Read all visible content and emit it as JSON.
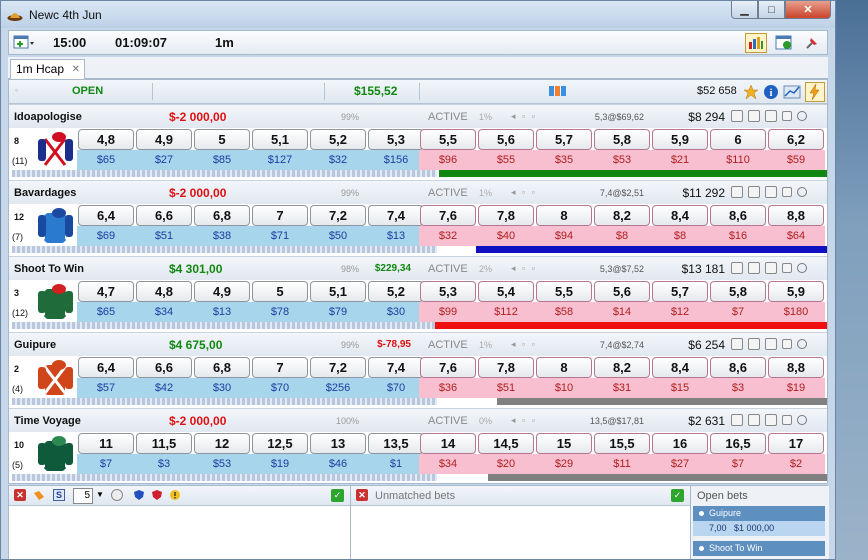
{
  "window": {
    "title": "Newc 4th Jun"
  },
  "toolbar": {
    "time": "15:00",
    "countdown": "01:09:07",
    "market": "1m"
  },
  "tab": {
    "label": "1m Hcap"
  },
  "status": {
    "state": "OPEN",
    "amount": "$155,52",
    "bank": "$52 658"
  },
  "runners": [
    {
      "name": "Idoapologise",
      "pl": "$-2 000,00",
      "pl_color": "#e01010",
      "pct": "99%",
      "extra": "",
      "extra_color": "#118811",
      "status": "ACTIVE",
      "status_pct": "1%",
      "last": "5,3@$69,62",
      "matched": "$8 294",
      "cloth": "8",
      "draw": "(11)",
      "back_odds": [
        "4,8",
        "4,9",
        "5",
        "5,1",
        "5,2",
        "5,3"
      ],
      "back_amts": [
        "$65",
        "$27",
        "$85",
        "$127",
        "$32",
        "$156"
      ],
      "lay_odds": [
        "5,5",
        "5,6",
        "5,7",
        "5,8",
        "5,9",
        "6",
        "6,2"
      ],
      "lay_amts": [
        "$96",
        "$55",
        "$35",
        "$53",
        "$21",
        "$110",
        "$59"
      ],
      "bar_color": "#118811",
      "bar_fraction": 0.95,
      "silk": {
        "body": "#ffffff",
        "cross": "#d01020",
        "sleeves": "#1b2f8a",
        "cap": "#d01020"
      }
    },
    {
      "name": "Bavardages",
      "pl": "$-2 000,00",
      "pl_color": "#e01010",
      "pct": "99%",
      "extra": "",
      "extra_color": "#118811",
      "status": "ACTIVE",
      "status_pct": "1%",
      "last": "7,4@$2,51",
      "matched": "$11 292",
      "cloth": "12",
      "draw": "(7)",
      "back_odds": [
        "6,4",
        "6,6",
        "6,8",
        "7",
        "7,2",
        "7,4"
      ],
      "back_amts": [
        "$69",
        "$51",
        "$38",
        "$71",
        "$50",
        "$13"
      ],
      "lay_odds": [
        "7,6",
        "7,8",
        "8",
        "8,2",
        "8,4",
        "8,6",
        "8,8"
      ],
      "lay_amts": [
        "$32",
        "$40",
        "$94",
        "$8",
        "$8",
        "$16",
        "$64"
      ],
      "bar_color": "#1010c0",
      "bar_fraction": 0.86,
      "silk": {
        "body": "#2a7ad0",
        "cross": "#2a7ad0",
        "sleeves": "#1a4aa0",
        "cap": "#1a4aa0"
      }
    },
    {
      "name": "Shoot To Win",
      "pl": "$4 301,00",
      "pl_color": "#118811",
      "pct": "98%",
      "extra": "$229,34",
      "extra_color": "#118811",
      "status": "ACTIVE",
      "status_pct": "2%",
      "last": "5,3@$7,52",
      "matched": "$13 181",
      "cloth": "3",
      "draw": "(12)",
      "back_odds": [
        "4,7",
        "4,8",
        "4,9",
        "5",
        "5,1",
        "5,2"
      ],
      "back_amts": [
        "$65",
        "$34",
        "$13",
        "$78",
        "$79",
        "$30"
      ],
      "lay_odds": [
        "5,3",
        "5,4",
        "5,5",
        "5,6",
        "5,7",
        "5,8",
        "5,9"
      ],
      "lay_amts": [
        "$99",
        "$112",
        "$58",
        "$14",
        "$12",
        "$7",
        "$180"
      ],
      "bar_color": "#ee1010",
      "bar_fraction": 0.96,
      "silk": {
        "body": "#1f6b3a",
        "cross": "#1f6b3a",
        "sleeves": "#1f6b3a",
        "cap": "#d02020"
      }
    },
    {
      "name": "Guipure",
      "pl": "$4 675,00",
      "pl_color": "#118811",
      "pct": "99%",
      "extra": "$-78,95",
      "extra_color": "#e01010",
      "status": "ACTIVE",
      "status_pct": "1%",
      "last": "7,4@$2,74",
      "matched": "$6 254",
      "cloth": "2",
      "draw": "(4)",
      "back_odds": [
        "6,4",
        "6,6",
        "6,8",
        "7",
        "7,2",
        "7,4"
      ],
      "back_amts": [
        "$57",
        "$42",
        "$30",
        "$70",
        "$256",
        "$70"
      ],
      "lay_odds": [
        "7,6",
        "7,8",
        "8",
        "8,2",
        "8,4",
        "8,6",
        "8,8"
      ],
      "lay_amts": [
        "$36",
        "$51",
        "$10",
        "$31",
        "$15",
        "$3",
        "$19"
      ],
      "bar_color": "#808080",
      "bar_fraction": 0.81,
      "silk": {
        "body": "#d0461a",
        "cross": "#ffffff",
        "sleeves": "#d0461a",
        "cap": "#d0461a"
      }
    },
    {
      "name": "Time Voyage",
      "pl": "$-2 000,00",
      "pl_color": "#e01010",
      "pct": "100%",
      "extra": "",
      "extra_color": "#118811",
      "status": "ACTIVE",
      "status_pct": "0%",
      "last": "13,5@$17,81",
      "matched": "$2 631",
      "cloth": "10",
      "draw": "(5)",
      "back_odds": [
        "11",
        "11,5",
        "12",
        "12,5",
        "13",
        "13,5"
      ],
      "back_amts": [
        "$7",
        "$3",
        "$53",
        "$19",
        "$46",
        "$1"
      ],
      "lay_odds": [
        "14",
        "14,5",
        "15",
        "15,5",
        "16",
        "16,5",
        "17"
      ],
      "lay_amts": [
        "$34",
        "$20",
        "$29",
        "$11",
        "$27",
        "$7",
        "$2"
      ],
      "bar_color": "#808080",
      "bar_fraction": 0.83,
      "silk": {
        "body": "#0f5a3a",
        "cross": "#0f5a3a",
        "sleeves": "#0f5a3a",
        "cap": "#2a8a50"
      }
    }
  ],
  "bottom": {
    "stake": "5",
    "unmatched_label": "Unmatched bets",
    "open_label": "Open bets",
    "open_bets": [
      {
        "runner": "Guipure",
        "odds": "7,00",
        "stake": "$1 000,00"
      },
      {
        "runner": "Shoot To Win"
      }
    ]
  }
}
